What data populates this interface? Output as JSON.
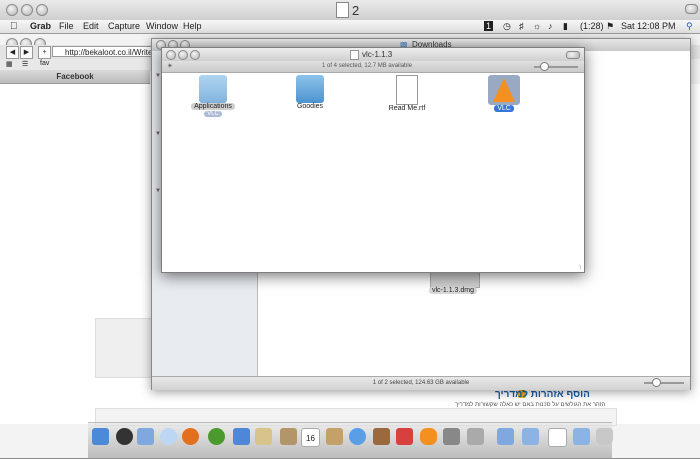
{
  "grab_window": {
    "title": "2"
  },
  "menubar": {
    "app": "Grab",
    "items": [
      "File",
      "Edit",
      "Capture",
      "Window",
      "Help"
    ],
    "battery": "(1:28)",
    "clock": "Sat 12:08 PM",
    "badge": "1"
  },
  "browser": {
    "url": "http://bekaloot.co.il/Write",
    "bookmark": "fav",
    "tab": "Facebook",
    "hebrew_heading": "הוסף אזהרות למדריך",
    "hebrew_sub": "הזהר את הגולשים על סכנות באם יש כאלה שקשורות למדריך"
  },
  "downloads_window": {
    "title": "Downloads",
    "status": "1 of 2 selected, 124.63 GB available",
    "dmg_label": "vlc-1.1.3.dmg"
  },
  "vlc_window": {
    "title": "vlc-1.1.3",
    "status": "1 of 4 selected, 12.7 MB available",
    "items": [
      {
        "label": "Applications",
        "badge": "VLC"
      },
      {
        "label": "Goodies"
      },
      {
        "label": "Read Me.rtf"
      },
      {
        "label": "VLC"
      }
    ]
  },
  "dock": {
    "calendar_day": "16"
  },
  "colors": {
    "selection": "#3875d7",
    "link": "#1a5ea8",
    "vlc_orange": "#f39020",
    "folder_blue": "#5aa0d8"
  }
}
